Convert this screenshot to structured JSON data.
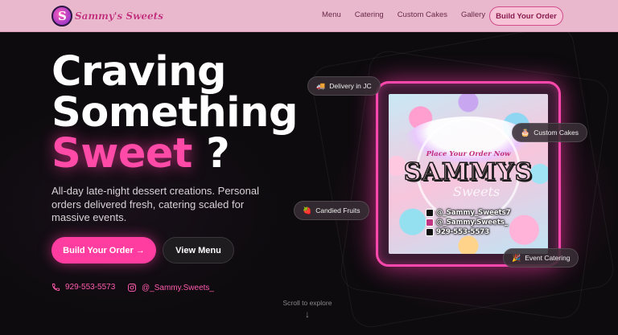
{
  "nav": {
    "logo_text": "Sammy's Sweets",
    "links": [
      "Menu",
      "Catering",
      "Custom Cakes",
      "Gallery"
    ],
    "cta": "Build Your Order"
  },
  "hero": {
    "headline_line1": "Craving",
    "headline_line2": "Something",
    "headline_accent": "Sweet",
    "headline_mark": "?",
    "tagline": "All-day late-night dessert creations. Personal orders delivered fresh, catering scaled for massive events.",
    "primary_button": "Build Your Order →",
    "secondary_button": "View Menu",
    "phone": "929-553-5573",
    "instagram": "@_Sammy.Sweets_",
    "scroll_hint": "Scroll to explore"
  },
  "poster": {
    "place_order": "Place Your Order Now",
    "brand": "SAMMYS",
    "script": "Sweets",
    "tiktok": "@_Sammy_Sweets7",
    "instagram": "@_Sammy.Sweets_",
    "phone": "929-553-5573"
  },
  "badges": {
    "delivery": "Delivery in JC",
    "custom_cakes": "Custom Cakes",
    "candied_fruits": "Candied Fruits",
    "event_catering": "Event Catering"
  },
  "colors": {
    "accent_pink": "#ff3da0",
    "nav_bg": "#e9b8cd",
    "page_bg": "#0c0a0d"
  }
}
